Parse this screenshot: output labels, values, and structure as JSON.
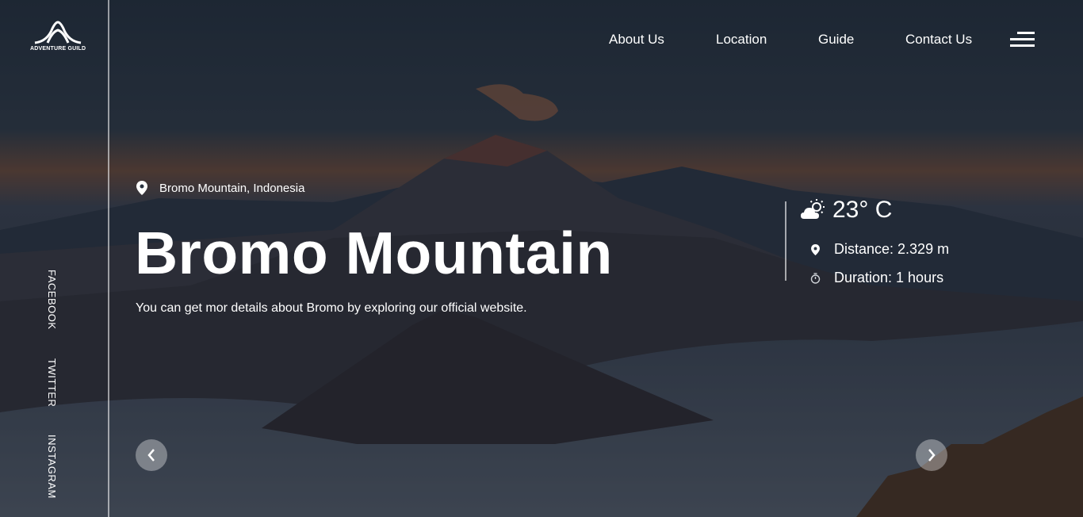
{
  "brand": {
    "name": "ADVENTURE GUILD"
  },
  "social": [
    {
      "label": "FACEBOOK"
    },
    {
      "label": "TWITTER"
    },
    {
      "label": "INSTAGRAM"
    }
  ],
  "nav": {
    "items": [
      {
        "label": "About Us"
      },
      {
        "label": "Location"
      },
      {
        "label": "Guide"
      },
      {
        "label": "Contact Us"
      }
    ],
    "menu_icon": "hamburger-icon"
  },
  "hero": {
    "location": "Bromo Mountain, Indonesia",
    "title": "Bromo Mountain",
    "description": "You can get mor details about Bromo by exploring our official website."
  },
  "info": {
    "temperature": "23° C",
    "distance": "Distance: 2.329 m",
    "duration": "Duration: 1 hours",
    "weather_icon": "partly-cloudy-icon",
    "distance_icon": "map-pin-icon",
    "duration_icon": "stopwatch-icon"
  },
  "controls": {
    "prev_icon": "chevron-left-icon",
    "next_icon": "chevron-right-icon"
  },
  "colors": {
    "background": "#1f2a36",
    "text": "#ffffff"
  }
}
